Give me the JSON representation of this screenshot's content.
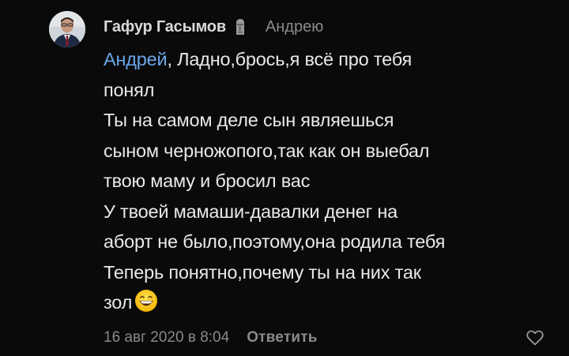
{
  "comment": {
    "author": "Гафур Гасымов",
    "reply_to": "Андрею",
    "mention": "Андрей",
    "text_lines": [
      ", Ладно,брось,я всё про тебя",
      "понял",
      "Ты на самом деле сын являешься",
      "сыном черножопого,так как он выебал",
      "твою маму и бросил вас",
      "У твоей мамаши-давалки денег на",
      "аборт не было,поэтому,она родила тебя",
      "Теперь понятно,почему ты на них так",
      "зол"
    ],
    "date": "16 авг 2020 в 8:04",
    "reply_label": "Ответить"
  },
  "icons": {
    "avatar": "user-photo",
    "status": "moai-icon",
    "emoji": "grinning-face-emoji",
    "like": "heart-outline-icon"
  },
  "colors": {
    "background": "#0a0a0a",
    "text": "#e9e9e9",
    "mention": "#6aa6e8",
    "secondary": "#8a8a8a"
  }
}
